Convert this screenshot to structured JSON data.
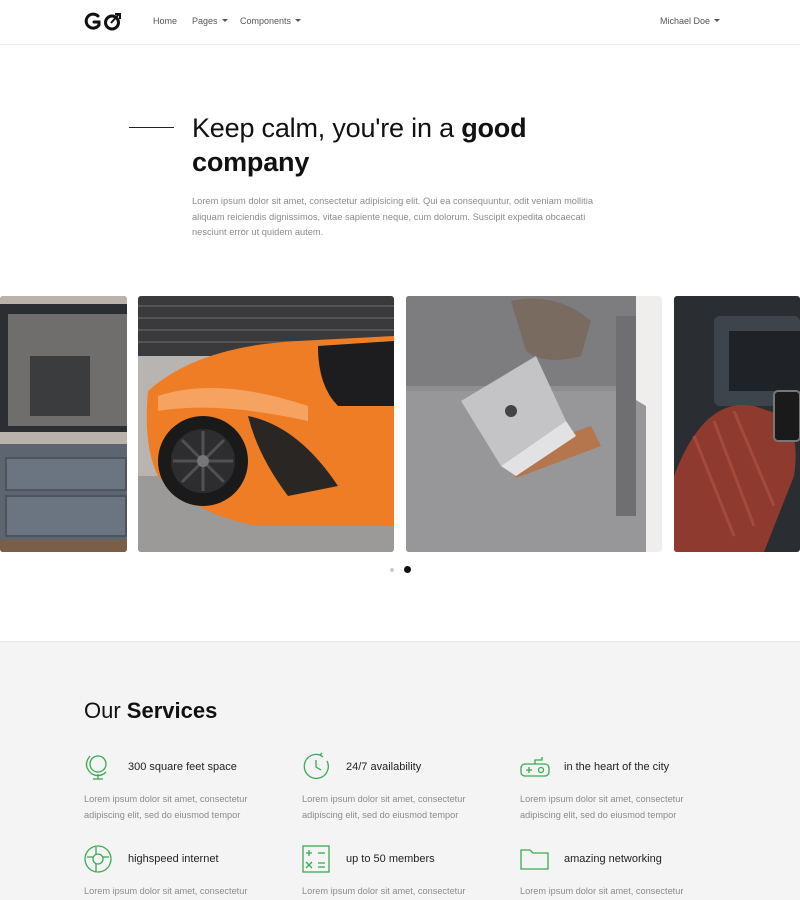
{
  "colors": {
    "accent": "#3aaa55",
    "text": "#111111",
    "muted": "#8b8b8b",
    "services_bg": "#f4f4f4"
  },
  "nav": {
    "logo_text": "GO",
    "links": [
      "Home",
      "Pages",
      "Components"
    ],
    "user": "Michael Doe"
  },
  "hero": {
    "title_light": "Keep calm, you're in a ",
    "title_bold_1": "good",
    "title_bold_2": "company",
    "text": "Lorem ipsum dolor sit amet, consectetur adipisicing elit. Qui ea consequuntur, odit veniam mollitia aliquam reiciendis dignissimos, vitae sapiente neque, cum dolorum. Suscipit expedita obcaecati nesciunt error ut quidem autem."
  },
  "carousel": {
    "slides": [
      "tv-stand-photo",
      "orange-sports-car-photo",
      "laptop-on-sofa-photo",
      "car-interior-wrist-photo"
    ],
    "active_page": 2,
    "page_count": 2
  },
  "services": {
    "title_light": "Our ",
    "title_bold": "Services",
    "items": [
      {
        "icon": "globe-icon",
        "title": "300 square feet space",
        "text": "Lorem ipsum dolor sit amet, consectetur adipiscing elit, sed do eiusmod tempor"
      },
      {
        "icon": "clock-icon",
        "title": "24/7 availability",
        "text": "Lorem ipsum dolor sit amet, consectetur adipiscing elit, sed do eiusmod tempor"
      },
      {
        "icon": "gamepad-icon",
        "title": "in the heart of the city",
        "text": "Lorem ipsum dolor sit amet, consectetur adipiscing elit, sed do eiusmod tempor"
      },
      {
        "icon": "lifebuoy-icon",
        "title": "highspeed internet",
        "text": "Lorem ipsum dolor sit amet, consectetur"
      },
      {
        "icon": "calculator-icon",
        "title": "up to 50 members",
        "text": "Lorem ipsum dolor sit amet, consectetur"
      },
      {
        "icon": "folder-icon",
        "title": "amazing networking",
        "text": "Lorem ipsum dolor sit amet, consectetur"
      }
    ]
  }
}
